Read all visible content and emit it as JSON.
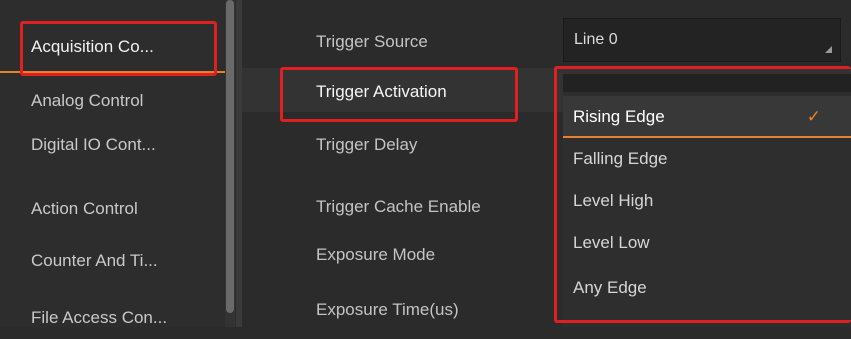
{
  "nav": {
    "items": [
      {
        "label": "Acquisition Co..."
      },
      {
        "label": "Analog Control"
      },
      {
        "label": "Digital IO Cont..."
      },
      {
        "label": "Action Control"
      },
      {
        "label": "Counter And Ti..."
      },
      {
        "label": "File Access Con..."
      }
    ],
    "active_index": 0
  },
  "properties": {
    "rows": [
      {
        "label": "Trigger Source"
      },
      {
        "label": "Trigger Activation"
      },
      {
        "label": "Trigger Delay"
      },
      {
        "label": "Trigger Cache Enable"
      },
      {
        "label": "Exposure Mode"
      },
      {
        "label": "Exposure Time(us)"
      }
    ],
    "trigger_source_value": "Line 0"
  },
  "dropdown": {
    "options": [
      {
        "label": "Rising Edge",
        "selected": true
      },
      {
        "label": "Falling Edge"
      },
      {
        "label": "Level High"
      },
      {
        "label": "Level Low"
      },
      {
        "label": "Any Edge"
      }
    ],
    "check_glyph": "✓"
  },
  "colors": {
    "accent": "#e8822a",
    "annotation": "#e02020",
    "background": "#2b2b2b"
  }
}
